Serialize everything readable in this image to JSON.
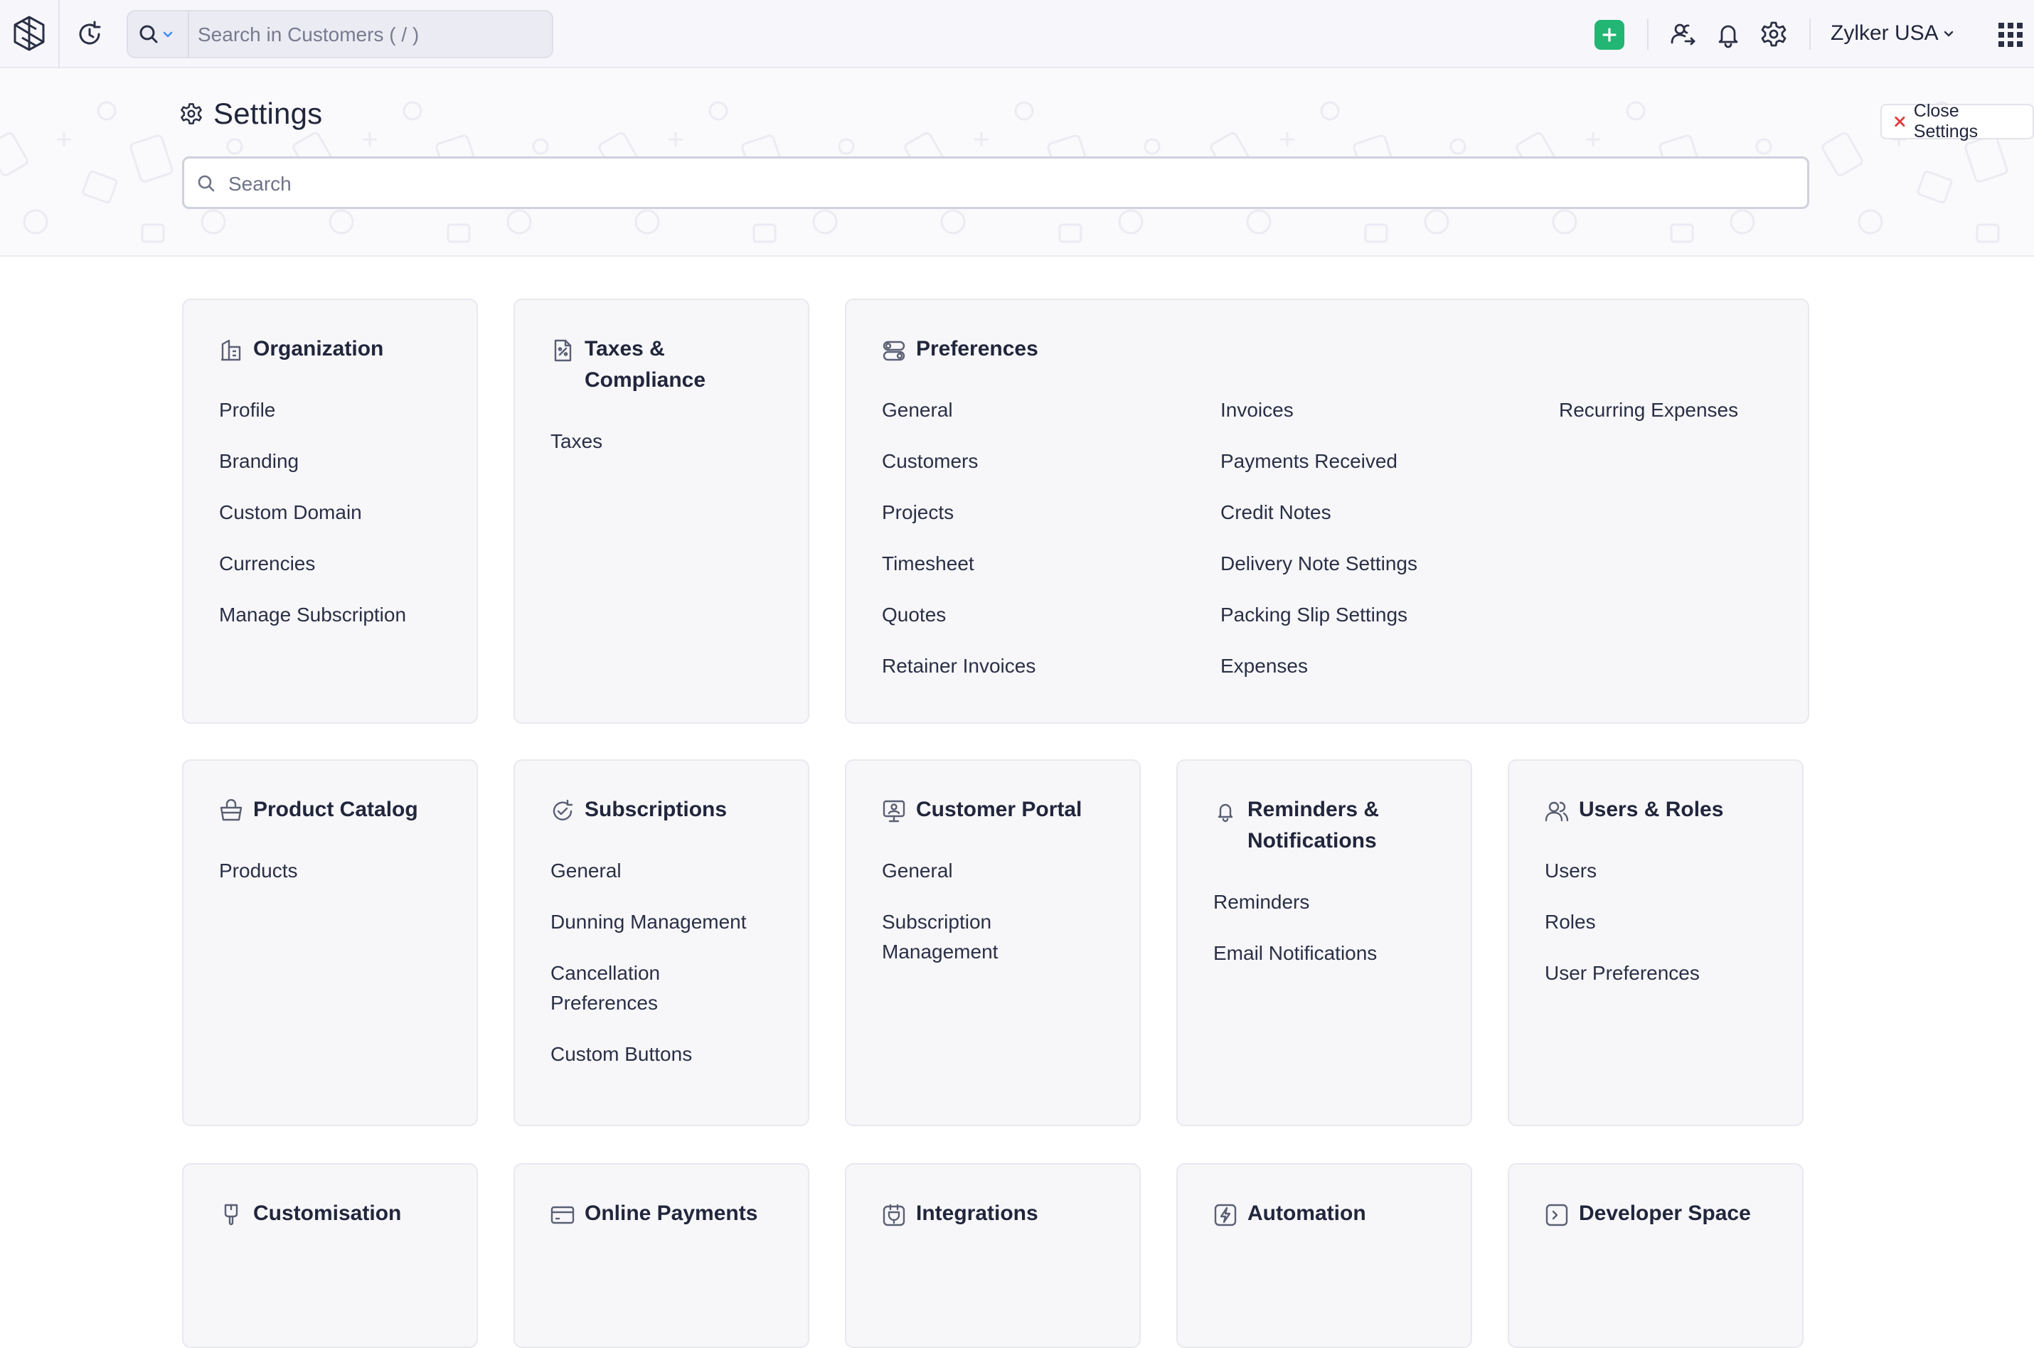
{
  "topbar": {
    "search_placeholder": "Search in Customers ( / )",
    "org_name": "Zylker USA",
    "icons": [
      "app-logo-icon",
      "recent-activity-icon",
      "search-icon",
      "chevron-down-icon",
      "plus-icon",
      "referral-icon",
      "bell-icon",
      "gear-icon",
      "apps-grid-icon"
    ],
    "accent_color": "#22b573"
  },
  "settings": {
    "title": "Settings",
    "close_label": "Close Settings",
    "search_placeholder": "Search"
  },
  "sections": {
    "organization": {
      "title": "Organization",
      "icon": "organization-icon",
      "links": [
        "Profile",
        "Branding",
        "Custom Domain",
        "Currencies",
        "Manage Subscription"
      ]
    },
    "taxes": {
      "title_line1": "Taxes &",
      "title_line2": "Compliance",
      "icon": "tax-doc-icon",
      "links": [
        "Taxes"
      ]
    },
    "preferences": {
      "title": "Preferences",
      "icon": "toggles-icon",
      "col1": [
        "General",
        "Customers",
        "Projects",
        "Timesheet",
        "Quotes",
        "Retainer Invoices"
      ],
      "col2": [
        "Invoices",
        "Payments Received",
        "Credit Notes",
        "Delivery Note Settings",
        "Packing Slip Settings",
        "Expenses"
      ],
      "col3": [
        "Recurring Expenses"
      ]
    },
    "product_catalog": {
      "title": "Product Catalog",
      "icon": "basket-icon",
      "links": [
        "Products"
      ]
    },
    "subscriptions": {
      "title": "Subscriptions",
      "icon": "refresh-check-icon",
      "links": [
        "General",
        "Dunning Management",
        "Cancellation Preferences",
        "Custom Buttons"
      ],
      "cancel_line1": "Cancellation",
      "cancel_line2": "Preferences"
    },
    "customer_portal": {
      "title": "Customer Portal",
      "icon": "portal-icon",
      "links": [
        "General",
        "Subscription Management"
      ],
      "sub_line1": "Subscription",
      "sub_line2": "Management"
    },
    "reminders": {
      "title_line1": "Reminders &",
      "title_line2": "Notifications",
      "icon": "bell-icon",
      "links": [
        "Reminders",
        "Email Notifications"
      ]
    },
    "users_roles": {
      "title": "Users & Roles",
      "icon": "users-icon",
      "links": [
        "Users",
        "Roles",
        "User Preferences"
      ]
    },
    "customisation": {
      "title": "Customisation",
      "icon": "brush-icon"
    },
    "online_payments": {
      "title": "Online Payments",
      "icon": "card-icon"
    },
    "integrations": {
      "title": "Integrations",
      "icon": "plug-icon"
    },
    "automation": {
      "title": "Automation",
      "icon": "bolt-icon"
    },
    "developer_space": {
      "title": "Developer Space",
      "icon": "terminal-icon"
    }
  }
}
